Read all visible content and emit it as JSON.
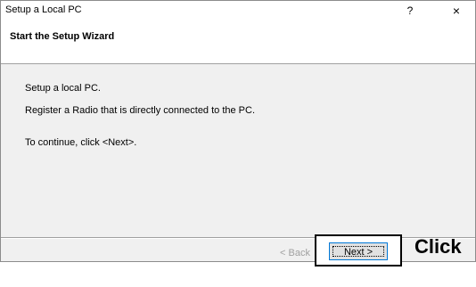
{
  "window": {
    "title": "Setup a Local PC",
    "help_label": "?",
    "close_label": "×"
  },
  "header": {
    "title": "Start the Setup Wizard"
  },
  "content": {
    "lines": [
      "Setup a local PC.",
      "Register a Radio that is directly connected to the PC.",
      "To continue, click <Next>."
    ]
  },
  "buttons": {
    "back_label": "< Back",
    "next_label": "Next >"
  },
  "annotation": {
    "click_label": "Click"
  }
}
